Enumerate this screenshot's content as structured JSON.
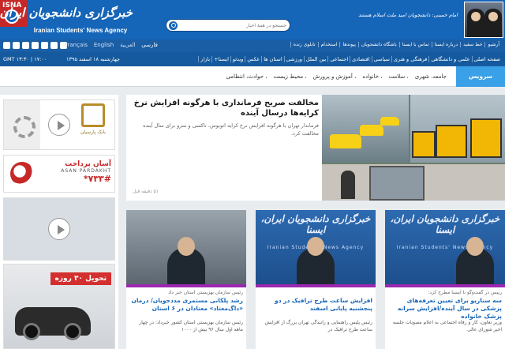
{
  "header": {
    "brand_badge": "ISNA",
    "brand_fa": "خبرگزاری دانشجویان ایران، ایسنا",
    "brand_en": "Iranian Students' News Agency",
    "search_placeholder": "جستجو در همهٔ اخبار",
    "motto": "امام خمینی: دانشجویان امید ملت اسلام هستند"
  },
  "langbar": {
    "languages": [
      "فارسی",
      "العربية",
      "English",
      "Français"
    ],
    "active_language": "فارسی",
    "links": [
      "آرشیو",
      "خط سفید",
      "درباره ایسنا",
      "تماس با ایسنا",
      "باشگاه دانشجویان",
      "پیوندها",
      "استخدام",
      "تابلوی زنده"
    ]
  },
  "catbar": {
    "gmt": "GMT ۱۳:۳۰ | ۱۷:۰۰",
    "date": "چهارشنبه ۱۸ اسفند ۱۳۹۵",
    "categories": [
      "صفحه اصلی",
      "علمی و دانشگاهی",
      "فرهنگی و هنری",
      "سیاسی",
      "اقتصادی",
      "اجتماعی",
      "بین الملل",
      "ورزشی",
      "استان ها",
      "عکس",
      "ویدئو",
      "ایسنا+",
      "بازار"
    ]
  },
  "service": {
    "title": "سرویس اجتماعی",
    "subcategories": [
      "جامعه، شهری",
      "سلامت",
      "خانواده",
      "آموزش و پرورش",
      "محیط زیست",
      "حوادث، انتظامی"
    ]
  },
  "ads": {
    "bank_name": "بانک پارسیان",
    "asan_fa": "آسان پرداخت",
    "asan_en": "ASAN PARDAKHT",
    "asan_code": "*۷۳۳#",
    "delivery": "تحویل ۳۰ روزه"
  },
  "feature": {
    "title": "مخالفت صریح فرمانداری با هرگونه افزایش نرخ کرایه‌ها درسال آینده",
    "lead": "فرماندار تهران با هرگونه افزایش نرخ کرایه اتوبوس، تاکسی و مترو برای سال آینده مخالفت کرد.",
    "time": "۵۱ دقیقه قبل"
  },
  "cards": [
    {
      "kicker": "رئیس سازمان بهزیستی استان خبر داد",
      "title": "رشد پلکانی مستمری مددجویان/ درمان «داگ‌معتاد» معتادان در ۶ استان",
      "lead": "رئیس سازمان بهزیستی استان کشور خبرداد: در چهار ماهه اول سال ۹۶ بیش از ۱۰۰۰"
    },
    {
      "kicker": "",
      "title": "افزایش ساعت طرح ترافیک در دو پنجشنبه پایانی اسفند",
      "lead": "رئیس پلیس راهنمایی و رانندگی تهران بزرگ از افزایش ساعت طرح ترافیک در"
    },
    {
      "kicker": "رییس در گفت‌وگو با ایسنا مطرح کرد:",
      "title": "سه سناریو برای تعیین تعرفه‌های پزشکی در سال آینده/افزایش سرانه پزشک خانواده",
      "lead": "وزیر تعاون، کار و رفاه اجتماعی به اعلام مصوبات جلسه اخیر شورای عالی"
    }
  ],
  "colors": {
    "header_blue": "#1565b8",
    "service_blue": "#3aa0e8",
    "brand_red": "#c62828",
    "card_tag_purple": "#9c27b0"
  }
}
